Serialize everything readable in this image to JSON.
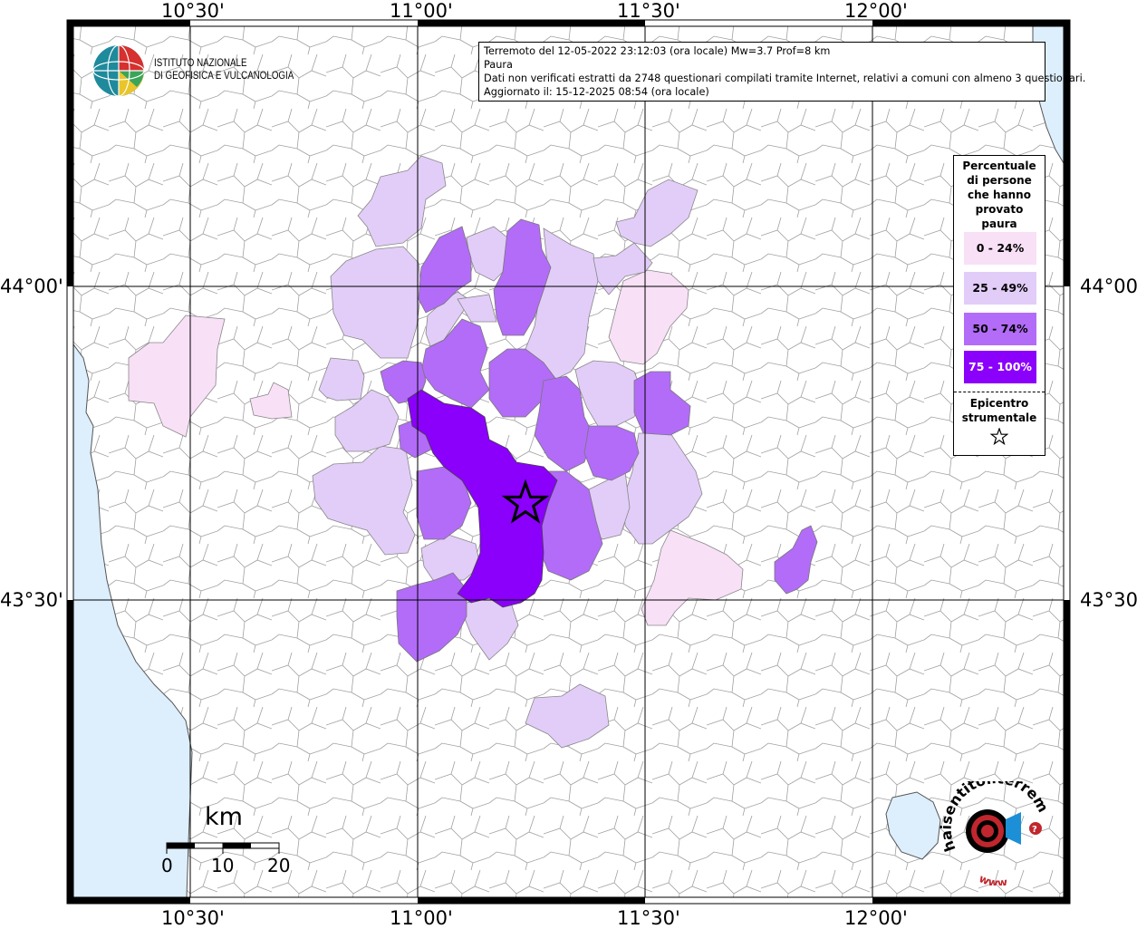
{
  "info": {
    "line1": "Terremoto del 12-05-2022 23:12:03 (ora locale) Mw=3.7 Prof=8 km",
    "line2": "Paura",
    "line3": "Dati non verificati estratti da 2748 questionari compilati tramite Internet, relativi a comuni con almeno 3 questionari.",
    "line4": "Aggiornato il: 15-12-2025 08:54 (ora locale)"
  },
  "logo": {
    "line1": "ISTITUTO NAZIONALE",
    "line2": "DI GEOFISICA E VULCANOLOGIA"
  },
  "axes": {
    "lon_top": [
      "10°30'",
      "11°00'",
      "11°30'",
      "12°00'"
    ],
    "lon_bottom": [
      "10°30'",
      "11°00'",
      "11°30'",
      "12°00'"
    ],
    "lat_left": [
      "44°00'",
      "43°30'"
    ],
    "lat_right": [
      "44°00'",
      "43°30'"
    ]
  },
  "legend": {
    "title_lines": [
      "Percentuale",
      "di persone",
      "che hanno",
      "provato",
      "paura"
    ],
    "classes": [
      {
        "label": "0 - 24%",
        "color": "#f8e0f6"
      },
      {
        "label": "25 - 49%",
        "color": "#e2cdf8"
      },
      {
        "label": "50 - 74%",
        "color": "#b26cf8"
      },
      {
        "label": "75 - 100%",
        "color": "#8a00fb"
      }
    ],
    "epicenter_lines": [
      "Epicentro",
      "strumentale"
    ]
  },
  "scale": {
    "unit": "km",
    "labels": [
      "0",
      "10",
      "20"
    ]
  },
  "watermark": {
    "text": "haisentitoilterremoto.it",
    "url": "www"
  },
  "colors": {
    "sea": "#ddeefc",
    "frame": "#000000",
    "border_lines": "#9a9a9a"
  }
}
